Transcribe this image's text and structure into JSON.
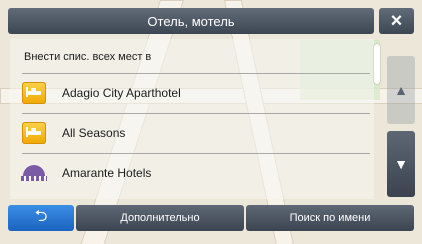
{
  "header": {
    "title": "Отель, мотель"
  },
  "list": {
    "show_all_label": "Внести спис. всех мест в",
    "items": [
      {
        "label": "Adagio City Aparthotel"
      },
      {
        "label": "All Seasons"
      },
      {
        "label": "Amarante Hotels"
      }
    ]
  },
  "bottom": {
    "more_label": "Дополнительно",
    "search_label": "Поиск по имени"
  },
  "icons": {
    "close": "×",
    "back": "⮌",
    "up": "▲",
    "down": "▼"
  }
}
